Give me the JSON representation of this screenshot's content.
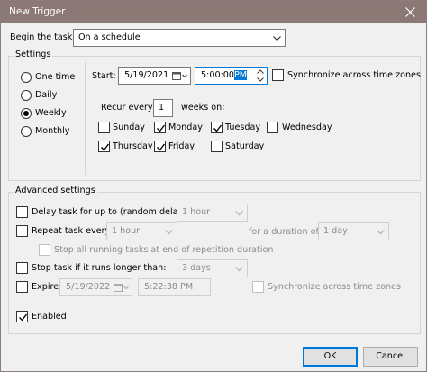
{
  "window": {
    "title": "New Trigger"
  },
  "begin": {
    "label": "Begin the task:",
    "value": "On a schedule"
  },
  "settings": {
    "legend": "Settings",
    "radios": [
      {
        "label": "One time",
        "checked": false
      },
      {
        "label": "Daily",
        "checked": false
      },
      {
        "label": "Weekly",
        "checked": true
      },
      {
        "label": "Monthly",
        "checked": false
      }
    ],
    "start_label": "Start:",
    "start_date": "5/19/2021",
    "start_time_prefix": "5:00:00",
    "start_time_ampm": "PM",
    "sync_label": "Synchronize across time zones",
    "sync_checked": false,
    "recur_label": "Recur every:",
    "recur_value": "1",
    "weeks_on_label": "weeks on:",
    "days": [
      {
        "label": "Sunday",
        "checked": false
      },
      {
        "label": "Monday",
        "checked": true
      },
      {
        "label": "Tuesday",
        "checked": true
      },
      {
        "label": "Wednesday",
        "checked": false
      },
      {
        "label": "Thursday",
        "checked": true
      },
      {
        "label": "Friday",
        "checked": true
      },
      {
        "label": "Saturday",
        "checked": false
      }
    ]
  },
  "advanced": {
    "legend": "Advanced settings",
    "delay_label": "Delay task for up to (random delay):",
    "delay_value": "1 hour",
    "repeat_label": "Repeat task every:",
    "repeat_value": "1 hour",
    "duration_label": "for a duration of:",
    "duration_value": "1 day",
    "stop_running_label": "Stop all running tasks at end of repetition duration",
    "stop_if_label": "Stop task if it runs longer than:",
    "stop_if_value": "3 days",
    "expire_label": "Expire:",
    "expire_date": "5/19/2022",
    "expire_time": "5:22:38 PM",
    "expire_sync_label": "Synchronize across time zones",
    "enabled_label": "Enabled",
    "enabled_checked": true
  },
  "buttons": {
    "ok": "OK",
    "cancel": "Cancel"
  },
  "colors": {
    "titlebar": "#8c7874",
    "accent": "#0078d7"
  }
}
